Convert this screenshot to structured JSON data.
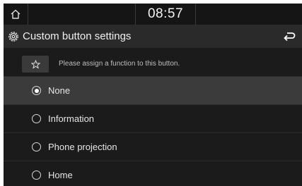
{
  "status": {
    "home_icon": "home-icon",
    "time": "08:57"
  },
  "title_bar": {
    "icon": "gear-icon",
    "title": "Custom button settings",
    "back_icon": "back-arrow-icon"
  },
  "info": {
    "icon": "star-icon",
    "text": "Please assign a function to this button."
  },
  "options": [
    {
      "label": "None",
      "selected": true
    },
    {
      "label": "Information",
      "selected": false
    },
    {
      "label": "Phone projection",
      "selected": false
    },
    {
      "label": "Home",
      "selected": false
    }
  ]
}
